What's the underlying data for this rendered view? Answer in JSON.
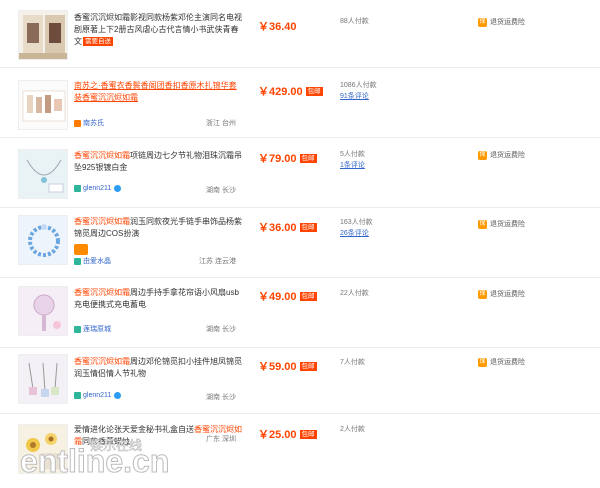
{
  "rows": [
    {
      "title": "香蜜沉沉烬如霜影视同款杨紫邓伦主演同名电视剧原著上下2册古风虐心古代言情小书武侠青春文",
      "title_hl": "",
      "tag": "需要自送",
      "seller": "",
      "location": "",
      "price": "￥36.40",
      "baoyou": "",
      "sales": "88人付款",
      "reviews": "",
      "guarantee": "退货运费险"
    },
    {
      "title_hl": "南苏之·香蜜衣香鬓香阁团香扣香原木扎锦华套装香蜜沉沉烬如霜",
      "title": "",
      "tag": "",
      "seller": "南苏氏",
      "location": "浙江 台州",
      "price": "￥429.00",
      "baoyou": "包邮",
      "sales": "1086人付款",
      "reviews": "91条评论",
      "guarantee": ""
    },
    {
      "title_hl": "香蜜沉沉烬如霜",
      "title": "项链周边七夕节礼物泪珠沉霜吊坠925银镀白金",
      "tag": "",
      "seller": "glenn211",
      "location": "湖南 长沙",
      "price": "￥79.00",
      "baoyou": "包邮",
      "sales": "5人付款",
      "reviews": "1条评论",
      "guarantee": "退货运费险"
    },
    {
      "title_hl": "香蜜沉沉烬如霜",
      "title": "润玉同款夜光手链手串饰品杨紫锦觅周边COS扮演",
      "tag": "",
      "seller": "由爱水晶",
      "location": "江苏 连云港",
      "price": "￥36.00",
      "baoyou": "包邮",
      "sales": "163人付款",
      "reviews": "26条评论",
      "guarantee": "退货运费险"
    },
    {
      "title_hl": "香蜜沉沉烬如霜",
      "title": "周边手持手拿花帘语小风扇usb充电便携式充电蓄电",
      "tag": "",
      "seller": "莲瑞原城",
      "location": "湖南 长沙",
      "price": "￥49.00",
      "baoyou": "包邮",
      "sales": "22人付款",
      "reviews": "",
      "guarantee": "退货运费险"
    },
    {
      "title_hl": "香蜜沉沉烬如霜",
      "title": "周边邓伦锦觅扣小挂件旭凤锦觅润玉情侣情人节礼物",
      "tag": "",
      "seller": "glenn211",
      "location": "湖南 长沙",
      "price": "￥59.00",
      "baoyou": "包邮",
      "sales": "7人付款",
      "reviews": "",
      "guarantee": "退货运费险"
    },
    {
      "title_pre": "爱情进化论张天爱金秘书礼盒自送",
      "title_hl": "香蜜沉沉烬如霜",
      "title": "同款香薰蜡烛",
      "tag": "",
      "seller": "",
      "location": "广东 深圳",
      "price": "￥25.00",
      "baoyou": "包邮",
      "sales": "2人付款",
      "reviews": "",
      "guarantee": ""
    }
  ],
  "watermark": "entline.cn 娱乐在线"
}
